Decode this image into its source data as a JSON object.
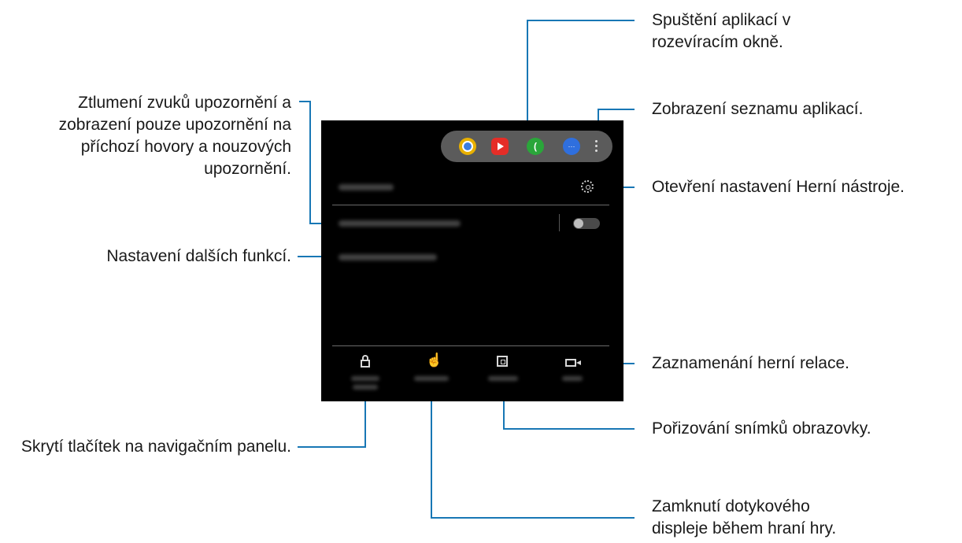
{
  "callouts": {
    "popup_apps": "Spuštění aplikací v rozevíracím okně.",
    "app_list": "Zobrazení seznamu aplikací.",
    "open_settings": "Otevření nastavení Herní nástroje.",
    "record": "Zaznamenání herní relace.",
    "screenshot": "Pořizování snímků obrazovky.",
    "lock_touch": "Zamknutí dotykového displeje během hraní hry.",
    "mute_alerts": "Ztlumení zvuků upozornění a zobrazení pouze upozornění na příchozí hovory a nouzových upozornění.",
    "more_features": "Nastavení dalších funkcí.",
    "hide_nav": "Skrytí tlačítek na navigačním panelu."
  },
  "colors": {
    "leader": "#1877b5",
    "screen": "#000000",
    "chrome": "#e8b000",
    "youtube": "#e52d27",
    "phone": "#2aa63a",
    "messages": "#2f6fde"
  },
  "icons": [
    "chrome-icon",
    "youtube-icon",
    "phone-icon",
    "messages-icon",
    "more-icon",
    "gear-icon",
    "lock-icon",
    "touch-lock-icon",
    "screenshot-icon",
    "record-icon",
    "toggle-switch"
  ]
}
